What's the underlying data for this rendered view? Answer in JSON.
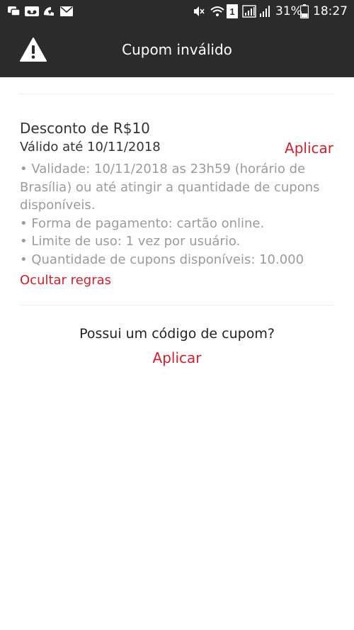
{
  "status_bar": {
    "icons_left": [
      "chat-icon",
      "voicemail-icon",
      "missed-call-icon",
      "mail-icon"
    ],
    "icons_right": [
      "muted-icon",
      "wifi-icon",
      "sim-1-icon",
      "signal-icon",
      "signal-icon",
      "battery-icon"
    ],
    "sim_slot": "1",
    "battery": "31%",
    "time": "18:27"
  },
  "header": {
    "title": "Cupom inválido",
    "icon": "warning-icon"
  },
  "coupon": {
    "title": "Desconto de R$10",
    "validity": "Válido até 10/11/2018",
    "apply_label": "Aplicar",
    "rules": [
      "• Validade: 10/11/2018 as 23h59 (horário de Brasília) ou até atingir a quantidade de cupons disponíveis.",
      "• Forma de pagamento: cartão online.",
      "• Limite de uso: 1 vez por usuário.",
      "• Quantidade de cupons disponíveis: 10.000"
    ],
    "hide_rules_label": "Ocultar regras"
  },
  "promo": {
    "question": "Possui um código de cupom?",
    "apply_label": "Aplicar"
  },
  "colors": {
    "header_bg": "#2b2b2b",
    "accent": "#d0202e",
    "muted_text": "#9b9b9b",
    "text": "#333333"
  }
}
